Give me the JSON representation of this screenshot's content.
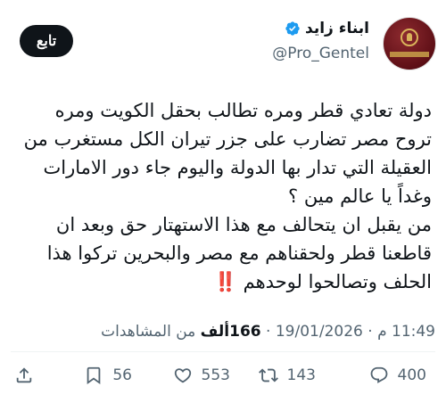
{
  "author": {
    "display_name": "ابناء زايد",
    "handle": "@Pro_Gentel",
    "avatar_icon": "emirates-passport-avatar",
    "verified_icon": "verified-badge-icon",
    "verified_color": "#1d9bf0"
  },
  "follow_button": {
    "label": "تابع"
  },
  "tweet": {
    "text": "دولة تعادي قطر ومره تطالب بحقل الكويت ومره تروح مصر تضارب على جزر تيران الكل مستغرب من العقيلة التي تدار بها الدولة واليوم جاء دور الامارات وغداً يا عالم مين ؟\nمن يقبل ان يتحالف مع هذا الاستهتار حق وبعد ان قاطعنا قطر ولحقناهم مع مصر والبحرين تركوا هذا الحلف وتصالحوا لوحدهم",
    "emoji": "‼️",
    "emoji_color": "#e0151c"
  },
  "meta": {
    "time": "11:49 م",
    "separator": " · ",
    "date": "19/01/2026",
    "views_count": "166ألف",
    "views_label": " من المشاهدات"
  },
  "actions": {
    "replies": "400",
    "retweets": "143",
    "likes": "553",
    "bookmarks": "56"
  },
  "colors": {
    "text": "#0f1419",
    "secondary": "#536471",
    "follow_bg": "#0f1419",
    "divider": "#eff3f4"
  }
}
